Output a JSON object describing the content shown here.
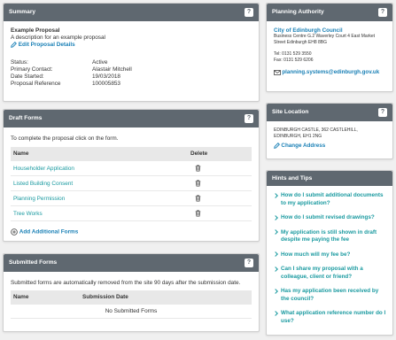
{
  "summary": {
    "title": "Summary",
    "help": "?",
    "proposal_name": "Example Proposal",
    "proposal_desc": "A description for an example proposal",
    "edit_label": "Edit Proposal Details",
    "fields": [
      {
        "label": "Status:",
        "value": "Active"
      },
      {
        "label": "Primary Contact:",
        "value": "Alastair Mitchell"
      },
      {
        "label": "Date Started:",
        "value": "19/03/2018"
      },
      {
        "label": "Proposal Reference",
        "value": "100005853"
      }
    ]
  },
  "draft": {
    "title": "Draft Forms",
    "help": "?",
    "intro": "To complete the proposal click on the form.",
    "col_name": "Name",
    "col_delete": "Delete",
    "rows": [
      {
        "name": "Householder Application"
      },
      {
        "name": "Listed Building Consent"
      },
      {
        "name": "Planning Permission"
      },
      {
        "name": "Tree Works"
      }
    ],
    "add_label": "Add Additional Forms"
  },
  "submitted": {
    "title": "Submitted Forms",
    "help": "?",
    "intro": "Submitted forms are automatically removed from the site 90 days after the submission date.",
    "col_name": "Name",
    "col_date": "Submission Date",
    "empty": "No Submitted Forms"
  },
  "authority": {
    "title": "Planning Authority",
    "help": "?",
    "name": "City of Edinburgh Council",
    "address1": "Business Centre G.2 Waverley Court 4 East Market",
    "address2": "Street Edinburgh EH8 8BG",
    "tel": "Tel: 0131 529 3550",
    "fax": "Fax: 0131 529 6206",
    "email": "planning.systems@edinburgh.gov.uk"
  },
  "site": {
    "title": "Site Location",
    "help": "?",
    "address1": "EDINBURGH CASTLE, 362 CASTLEHILL,",
    "address2": "EDINBURGH, EH1 2NG",
    "change_label": "Change Address"
  },
  "hints": {
    "title": "Hints and Tips",
    "items": [
      "How do I submit additional documents to my application?",
      "How do I submit revised drawings?",
      "My application is still shown in draft despite me paying the fee",
      "How much will my fee be?",
      "Can I share my proposal with a colleague, client or friend?",
      "Has my application been received by the council?",
      "What application reference number do I use?"
    ]
  }
}
